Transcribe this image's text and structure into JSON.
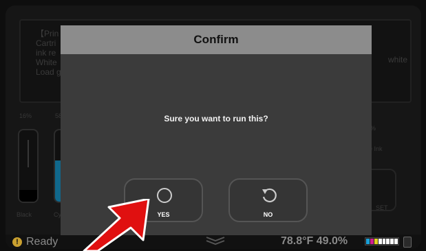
{
  "message_panel": {
    "text": "【Prin\nCartri\nink re\nWhite\nLoad g",
    "right_text": "white"
  },
  "ink_levels": {
    "black": {
      "percent_label": "16%",
      "label": "Black",
      "level": 0.16,
      "color": "#000000"
    },
    "cyan": {
      "percent_label": "58",
      "label": "Cy",
      "level": 0.58,
      "color": "#1aa0d8"
    }
  },
  "right_panel": {
    "percent_label": "%",
    "ink_label": "e Ink",
    "set_label": "SET"
  },
  "dialog": {
    "title": "Confirm",
    "message": "Sure you want to run this?",
    "yes_label": "YES",
    "no_label": "NO"
  },
  "status_bar": {
    "status": "Ready",
    "status_icon": "!",
    "temperature": "78.8°F",
    "humidity": "49.0%",
    "ink_bar_colors": [
      "#1aa0d8",
      "#d02090",
      "#e0d020",
      "#ffffff",
      "#ffffff",
      "#ffffff",
      "#ffffff",
      "#ffffff"
    ]
  },
  "colors": {
    "dialog_title_bg": "#8c8c8c",
    "dialog_bg": "#3b3b3b",
    "arrow": "#e01010"
  }
}
